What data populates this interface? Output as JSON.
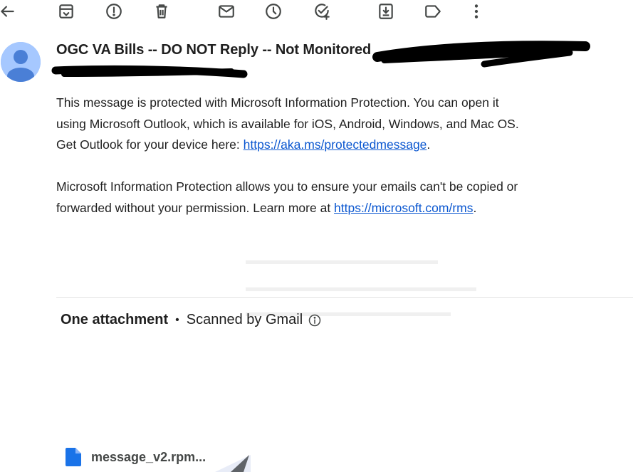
{
  "toolbar": {
    "buttons": [
      {
        "name": "back-arrow-icon"
      },
      {
        "name": "archive-icon"
      },
      {
        "name": "report-spam-icon"
      },
      {
        "name": "delete-icon"
      },
      {
        "name": "mark-unread-icon"
      },
      {
        "name": "snooze-icon"
      },
      {
        "name": "add-to-tasks-icon"
      },
      {
        "name": "move-to-icon"
      },
      {
        "name": "label-icon"
      },
      {
        "name": "more-options-icon"
      }
    ]
  },
  "sender": {
    "name": "OGC VA Bills -- DO NOT Reply -- Not Monitored",
    "avatar_color": "#a6c8ff",
    "avatar_figure_color": "#4a7fd6"
  },
  "body": {
    "paragraph1_text": "This message is protected with Microsoft Information Protection. You can open it using Microsoft Outlook, which is available for iOS, Android, Windows, and Mac OS. Get Outlook for your device here: ",
    "paragraph1_link": "https://aka.ms/protectedmessage",
    "paragraph1_end": ".",
    "paragraph2_text": "Microsoft Information Protection allows you to ensure your emails can't be copied or forwarded without your permission. Learn more at ",
    "paragraph2_link": "https://microsoft.com/rms",
    "paragraph2_end": ".",
    "link_color": "#0b57d0"
  },
  "attachments": {
    "title": "One attachment",
    "separator": "•",
    "scanned_label": "Scanned by Gmail",
    "file": {
      "name": "message_v2.rpm...",
      "icon": "file-doc-icon",
      "icon_color": "#1a73e8"
    }
  }
}
